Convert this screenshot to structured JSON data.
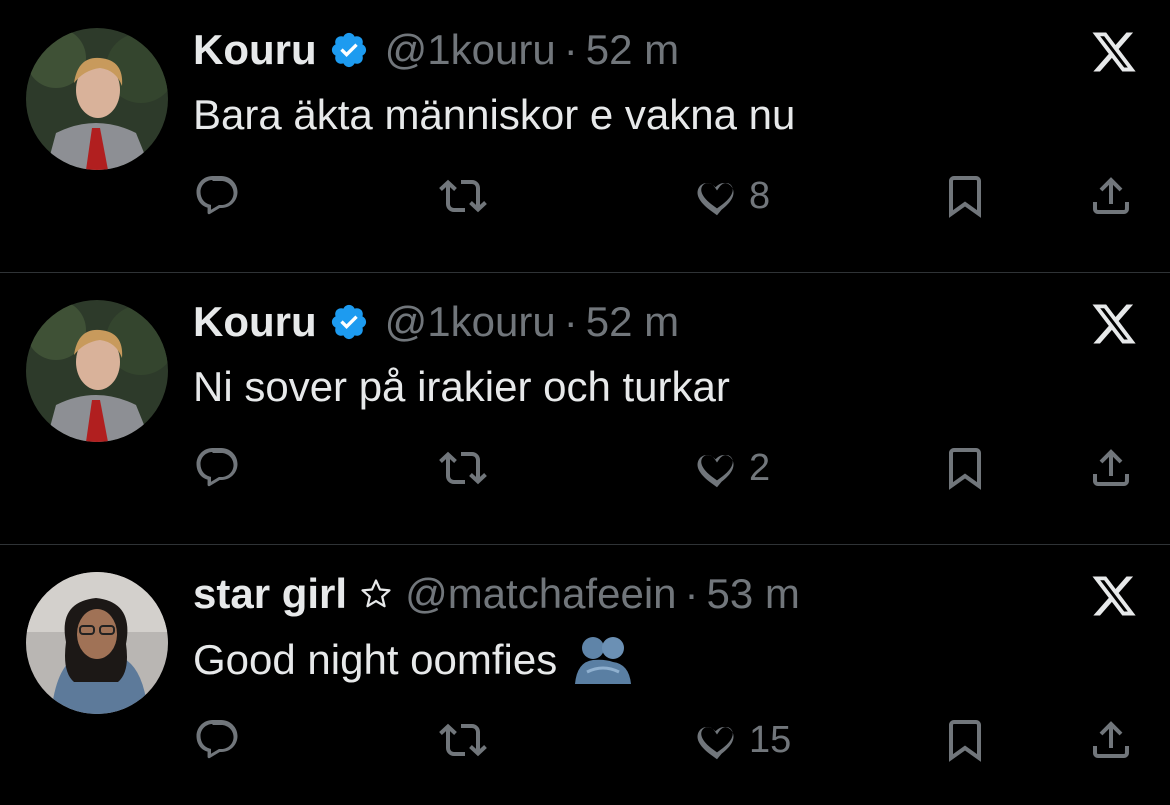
{
  "tweets": [
    {
      "name": "Kouru",
      "verified": true,
      "handle": "@1kouru",
      "separator": "·",
      "time": "52 m",
      "text": "Bara äkta människor e vakna nu",
      "likes": "8"
    },
    {
      "name": "Kouru",
      "verified": true,
      "handle": "@1kouru",
      "separator": "·",
      "time": "52 m",
      "text": "Ni sover på irakier och turkar",
      "likes": "2"
    },
    {
      "name": "star girl",
      "verified": false,
      "name_emoji": "star-icon",
      "handle": "@matchafeein",
      "separator": "·",
      "time": "53 m",
      "text": "Good night oomfies",
      "text_emoji": "people-hugging-icon",
      "likes": "15"
    }
  ],
  "colors": {
    "background": "#000000",
    "text": "#e7e9ea",
    "muted": "#71767b",
    "verified": "#1d9bf0",
    "divider": "#2f3336"
  }
}
